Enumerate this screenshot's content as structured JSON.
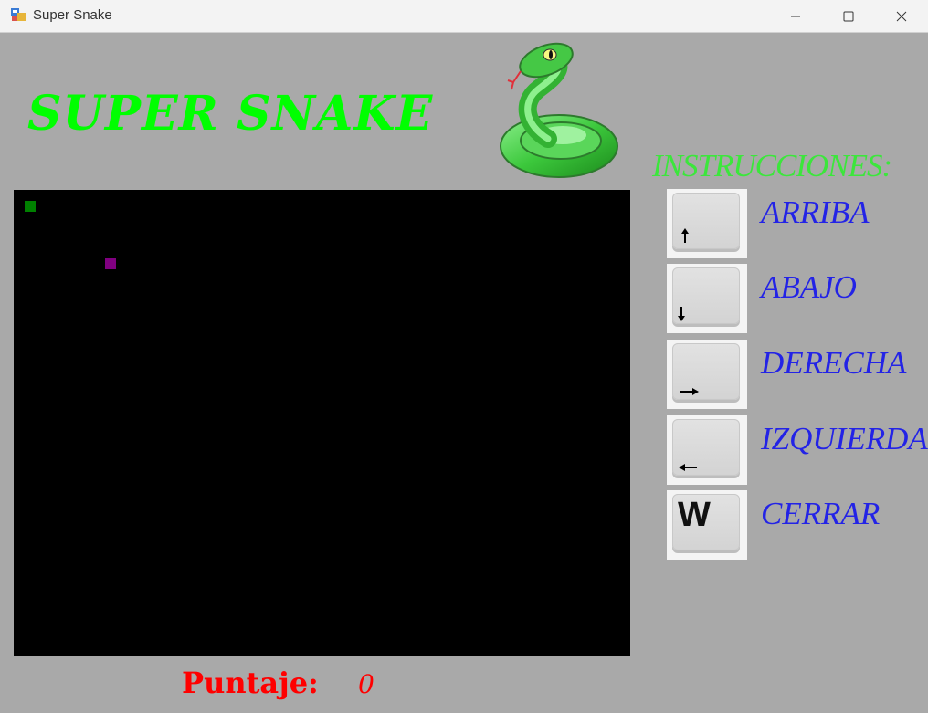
{
  "window": {
    "title": "Super Snake",
    "controls": [
      "minimize",
      "maximize",
      "close"
    ]
  },
  "header": {
    "title": "SUPER SNAKE",
    "logo_icon": "snake-icon"
  },
  "board": {
    "background": "#000000",
    "snake_color": "#008000",
    "food_color": "#800080",
    "snake_cells": [
      {
        "col": 1,
        "row": 1
      }
    ],
    "food_cells": [
      {
        "col": 8,
        "row": 6
      }
    ]
  },
  "score": {
    "label": "Puntaje:",
    "value": "0"
  },
  "instructions": {
    "heading": "INSTRUCCIONES:",
    "items": [
      {
        "key_icon": "arrow-up-icon",
        "label": "ARRIBA"
      },
      {
        "key_icon": "arrow-down-icon",
        "label": "ABAJO"
      },
      {
        "key_icon": "arrow-right-icon",
        "label": "DERECHA"
      },
      {
        "key_icon": "arrow-left-icon",
        "label": "IZQUIERDA"
      },
      {
        "key_text": "W",
        "label": "CERRAR"
      }
    ]
  },
  "colors": {
    "title_green": "#00ff00",
    "instructions_green": "#3ce63c",
    "instructions_blue": "#2323e6",
    "score_red": "#ff0000",
    "form_gray": "#a9a9a9"
  }
}
